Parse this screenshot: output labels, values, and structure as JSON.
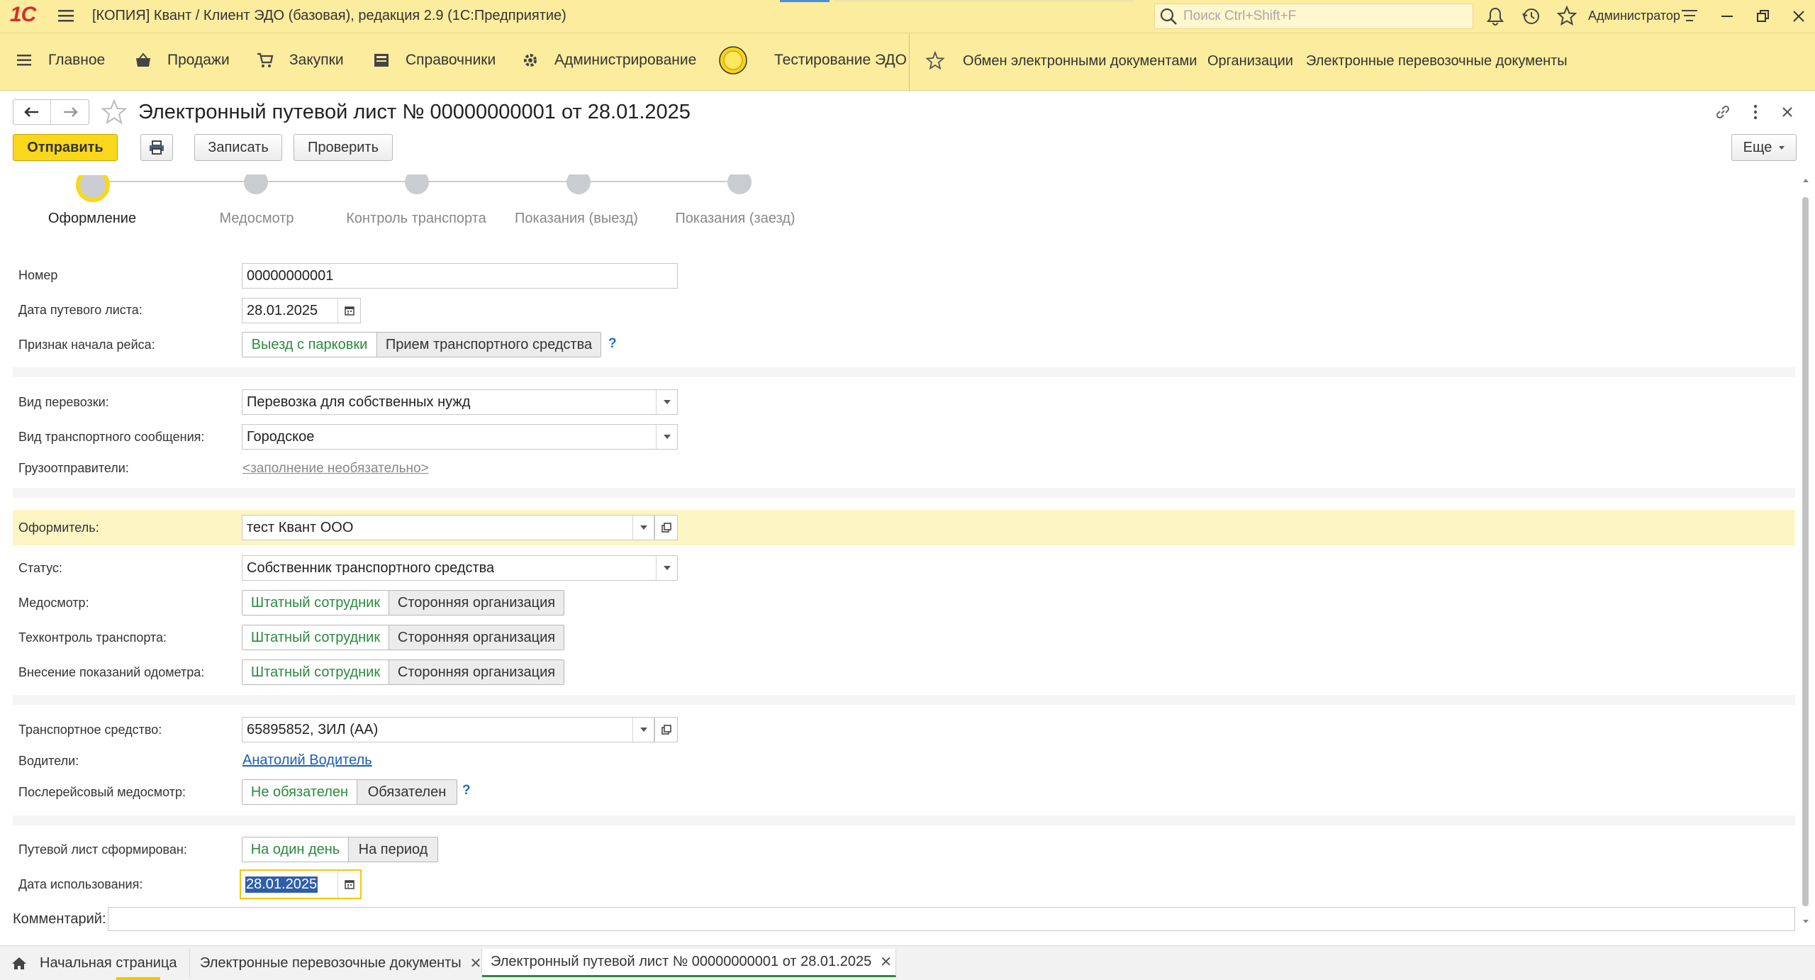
{
  "app": {
    "logo": "1С",
    "title": "[КОПИЯ] Квант / Клиент ЭДО (базовая), редакция 2.9  (1С:Предприятие)",
    "search_placeholder": "Поиск Ctrl+Shift+F",
    "user": "Администратор"
  },
  "sections": {
    "items": [
      {
        "label": "Главное",
        "icon": "menu-icon"
      },
      {
        "label": "Продажи",
        "icon": "basket-icon"
      },
      {
        "label": "Закупки",
        "icon": "cart-icon"
      },
      {
        "label": "Справочники",
        "icon": "book-icon"
      },
      {
        "label": "Администрирование",
        "icon": "gear-icon"
      },
      {
        "label": "Тестирование ЭДО",
        "icon": "circle-icon"
      }
    ],
    "favorites": [
      "Обмен электронными документами",
      "Организации",
      "Электронные перевозочные документы"
    ]
  },
  "form": {
    "title": "Электронный путевой лист № 00000000001 от 28.01.2025",
    "toolbar": {
      "send": "Отправить",
      "save": "Записать",
      "check": "Проверить",
      "more": "Еще"
    },
    "steps": [
      "Оформление",
      "Медосмотр",
      "Контроль транспорта",
      "Показания (выезд)",
      "Показания (заезд)"
    ],
    "fields": {
      "number": {
        "label": "Номер",
        "value": "00000000001"
      },
      "date": {
        "label": "Дата путевого листа:",
        "value": "28.01.2025"
      },
      "trip_start": {
        "label": "Признак начала рейса:",
        "options": [
          "Выезд с парковки",
          "Прием транспортного средства"
        ],
        "help": "?"
      },
      "transport_kind": {
        "label": "Вид перевозки:",
        "value": "Перевозка для собственных нужд"
      },
      "communication_kind": {
        "label": "Вид транспортного сообщения:",
        "value": "Городское"
      },
      "shippers": {
        "label": "Грузоотправители:",
        "value": "<заполнение необязательно>"
      },
      "issuer": {
        "label": "Оформитель:",
        "value": "тест Квант ООО"
      },
      "status": {
        "label": "Статус:",
        "value": "Собственник транспортного средства"
      },
      "medical": {
        "label": "Медосмотр:",
        "options": [
          "Штатный сотрудник",
          "Сторонняя организация"
        ]
      },
      "tech_control": {
        "label": "Техконтроль транспорта:",
        "options": [
          "Штатный сотрудник",
          "Сторонняя организация"
        ]
      },
      "odometer": {
        "label": "Внесение показаний одометра:",
        "options": [
          "Штатный сотрудник",
          "Сторонняя организация"
        ]
      },
      "vehicle": {
        "label": "Транспортное средство:",
        "value": "65895852, ЗИЛ  (АА)"
      },
      "drivers": {
        "label": "Водители:",
        "value": "Анатолий Водитель"
      },
      "post_trip_medical": {
        "label": "Послерейсовый медосмотр:",
        "options": [
          "Не обязателен",
          "Обязателен"
        ],
        "help": "?"
      },
      "formed": {
        "label": "Путевой лист сформирован:",
        "options": [
          "На один день",
          "На период"
        ]
      },
      "use_date": {
        "label": "Дата использования:",
        "value": "28.01.2025"
      },
      "comment": {
        "label": "Комментарий:",
        "value": ""
      }
    }
  },
  "tabs": [
    {
      "label": "Начальная страница"
    },
    {
      "label": "Электронные перевозочные документы"
    },
    {
      "label": "Электронный путевой лист № 00000000001 от 28.01.2025"
    }
  ],
  "colors": {
    "accent_yellow": "#fbec9e",
    "send_button": "#f9d71c",
    "toggle_on": "#2b8a3e",
    "link": "#1a5fb4"
  }
}
